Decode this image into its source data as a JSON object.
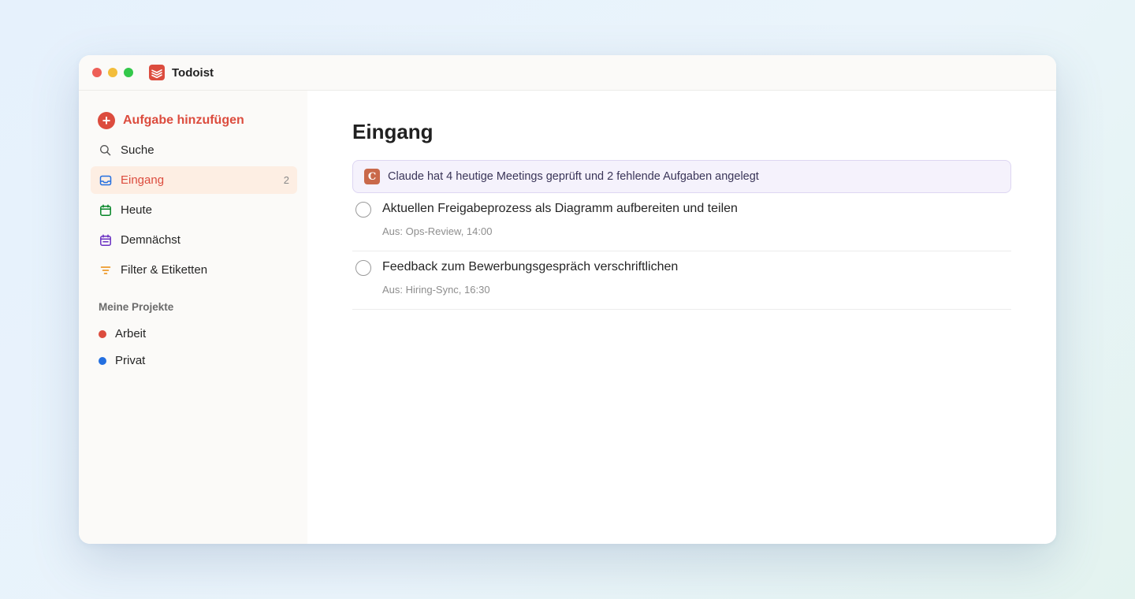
{
  "window": {
    "title": "Todoist",
    "brand_color": "#dc4c3e"
  },
  "sidebar": {
    "add_task_label": "Aufgabe hinzufügen",
    "items": [
      {
        "label": "Suche",
        "icon": "search-icon",
        "count": ""
      },
      {
        "label": "Eingang",
        "icon": "inbox-icon",
        "count": "2",
        "active": true
      },
      {
        "label": "Heute",
        "icon": "calendar-today-icon",
        "count": ""
      },
      {
        "label": "Demnächst",
        "icon": "calendar-upcoming-icon",
        "count": ""
      },
      {
        "label": "Filter & Etiketten",
        "icon": "filter-icon",
        "count": ""
      }
    ],
    "projects_title": "Meine Projekte",
    "projects": [
      {
        "label": "Arbeit",
        "color": "#dc4c3e"
      },
      {
        "label": "Privat",
        "color": "#246fe0"
      }
    ]
  },
  "main": {
    "title": "Eingang",
    "banner": {
      "badge": "C",
      "text": "Claude hat 4 heutige Meetings geprüft und 2 fehlende Aufgaben angelegt"
    },
    "tasks": [
      {
        "title": "Aktuellen Freigabeprozess als Diagramm aufbereiten und teilen",
        "meta": "Aus: Ops-Review, 14:00"
      },
      {
        "title": "Feedback zum Bewerbungsgespräch verschriftlichen",
        "meta": "Aus: Hiring-Sync, 16:30"
      }
    ]
  }
}
